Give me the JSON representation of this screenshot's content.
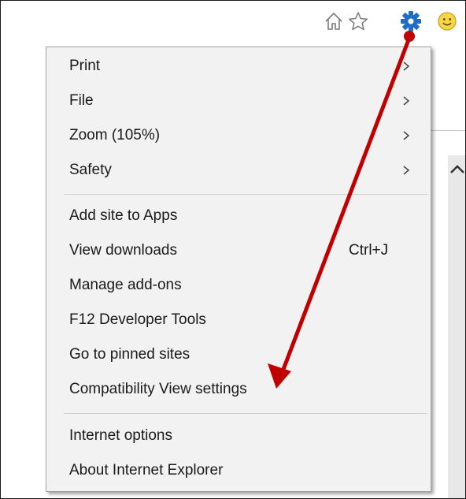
{
  "toolbar": {
    "icons": [
      "home-icon",
      "favorites-star-icon",
      "tools-gear-icon",
      "smiley-feedback-icon"
    ]
  },
  "menu": {
    "group1": [
      {
        "label": "Print",
        "submenu": true
      },
      {
        "label": "File",
        "submenu": true
      },
      {
        "label": "Zoom (105%)",
        "submenu": true
      },
      {
        "label": "Safety",
        "submenu": true
      }
    ],
    "group2": [
      {
        "label": "Add site to Apps"
      },
      {
        "label": "View downloads",
        "shortcut": "Ctrl+J"
      },
      {
        "label": "Manage add-ons"
      },
      {
        "label": "F12 Developer Tools"
      },
      {
        "label": "Go to pinned sites"
      },
      {
        "label": "Compatibility View settings"
      }
    ],
    "group3": [
      {
        "label": "Internet options"
      },
      {
        "label": "About Internet Explorer"
      }
    ]
  },
  "colors": {
    "gear": "#1e6fc4",
    "annotation_arrow": "#c00000",
    "menu_background": "#f2f2f2"
  }
}
